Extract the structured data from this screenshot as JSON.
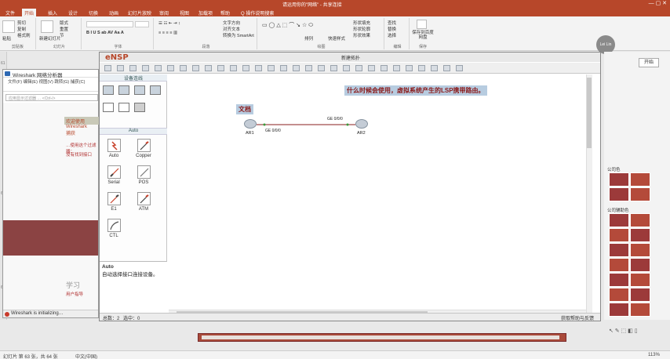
{
  "powerpoint": {
    "title": "请运用你的\"网络\" - 共享连接",
    "tabs": [
      "文件",
      "开始",
      "插入",
      "设计",
      "切换",
      "动画",
      "幻灯片放映",
      "审阅",
      "视图",
      "加载项",
      "帮助",
      "Q 操作说明搜索"
    ],
    "ribbon": {
      "paste": "粘贴",
      "cut": "剪切",
      "copy": "复制",
      "format_painter": "格式刷",
      "clipboard": "剪贴板",
      "new_slide": "新建幻灯片",
      "layout": "版式",
      "reset": "重置",
      "section": "节",
      "slides": "幻灯片",
      "font": "字体",
      "paragraph": "段落",
      "text_direction": "文字方向",
      "align_text": "对齐文本",
      "convert_smartart": "转换为 SmartArt",
      "drawing": "绘图",
      "arrange": "排列",
      "quick_styles": "快速样式",
      "shape_fill": "形状填充",
      "shape_outline": "形状轮廓",
      "shape_effects": "形状效果",
      "find": "查找",
      "replace": "替换",
      "select": "选择",
      "editing": "编辑",
      "save_baidu": "保存到百度网盘",
      "save": "保存"
    },
    "user": "Lei Lin"
  },
  "wireshark": {
    "title": "Wireshark 网络分析器",
    "menu": [
      "文件(F)",
      "编辑(E)",
      "视图(V)",
      "跳转(G)",
      "捕获(C)",
      "分析(A)",
      "统计(S)"
    ],
    "filter_placeholder": "应用显示过滤器 … <Ctrl-/>",
    "welcome": "欢迎使用 Wireshark",
    "capture": "捕获",
    "using_filter": "…使用这个过滤器：",
    "no_interfaces": "没有找到接口",
    "learn": "学习",
    "user_guide": "用户指导",
    "status": "Wireshark is initializing…"
  },
  "ensp": {
    "logo": "eNSP",
    "title": "新建拓扑",
    "sidebar_title": "设备连线",
    "cable_group": "Auto",
    "cables": [
      {
        "name": "Auto"
      },
      {
        "name": "Copper"
      },
      {
        "name": "Serial"
      },
      {
        "name": "POS"
      },
      {
        "name": "E1"
      },
      {
        "name": "ATM"
      },
      {
        "name": "CTL"
      }
    ],
    "desc_title": "Auto",
    "desc_body": "自动选择接口连接设备。",
    "canvas": {
      "note": "什么时候会使用，虚拟系统产生的LSP携带路由。",
      "tag": "文档",
      "routers": [
        {
          "label": "AR1",
          "port": "GE 0/0/0"
        },
        {
          "label": "AR2",
          "port": "GE 0/0/0"
        }
      ]
    },
    "status_total": "总数：2",
    "status_selected": "选中：0",
    "status_help": "获取帮助与反馈"
  },
  "right_panel": {
    "start": "开始",
    "section1": "公司色",
    "section2": "公司辅助色"
  },
  "status_bar": {
    "slide": "幻灯片 第 63 张，共 64 张",
    "lang": "中文(中国)",
    "zoom": "113%"
  }
}
